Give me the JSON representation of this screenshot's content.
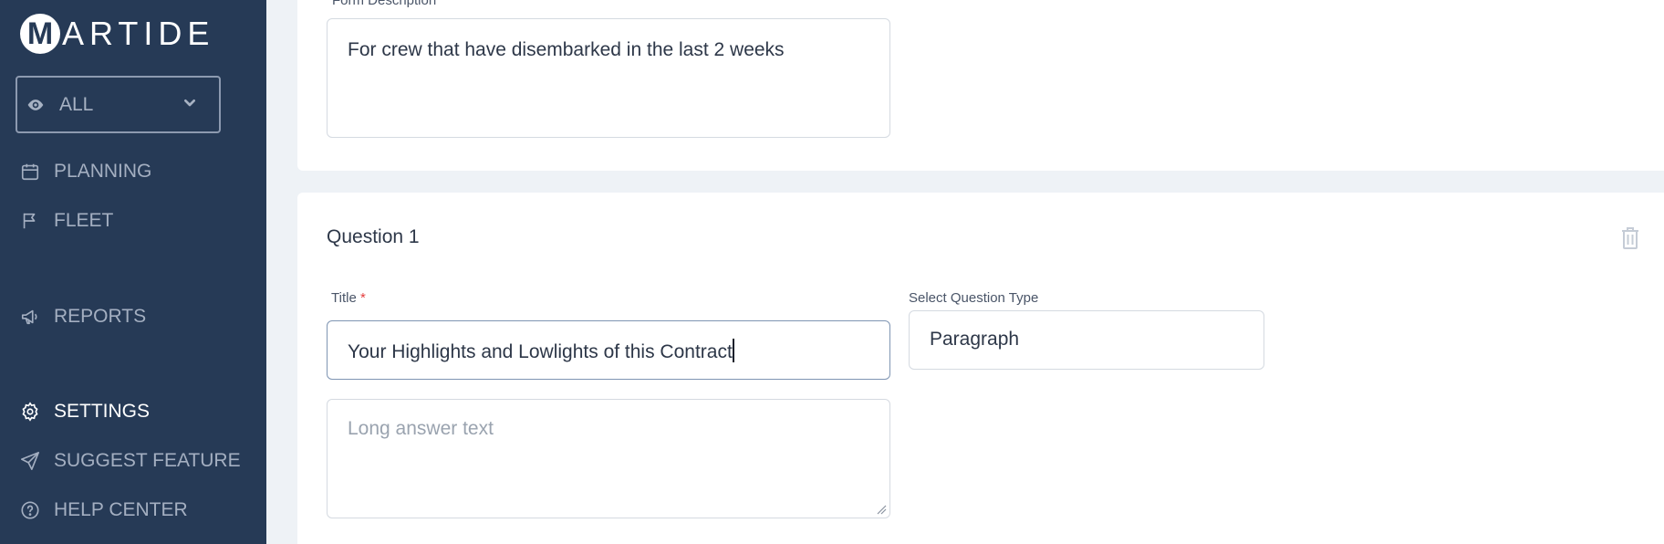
{
  "brand": {
    "logo_letter": "M",
    "logo_text": "ARTIDE"
  },
  "sidebar": {
    "view_select": {
      "value": "ALL",
      "icon": "eye-icon"
    },
    "items": [
      {
        "label": "PLANNING",
        "icon": "calendar-icon",
        "active": false
      },
      {
        "label": "FLEET",
        "icon": "flag-icon",
        "active": false
      },
      {
        "label": "REPORTS",
        "icon": "megaphone-icon",
        "active": false
      },
      {
        "label": "SETTINGS",
        "icon": "gear-icon",
        "active": true
      },
      {
        "label": "SUGGEST FEATURE",
        "icon": "send-icon",
        "active": false
      },
      {
        "label": "HELP CENTER",
        "icon": "help-circle-icon",
        "active": false
      }
    ]
  },
  "form": {
    "description_label": "Form Description",
    "description_value": "For crew that have disembarked in the last 2 weeks"
  },
  "question": {
    "heading": "Question 1",
    "title_label": "Title",
    "required_mark": "*",
    "title_value": "Your Highlights and Lowlights of this Contract",
    "type_label": "Select Question Type",
    "type_value": "Paragraph",
    "answer_placeholder": "Long answer text"
  },
  "colors": {
    "sidebar_bg": "#263a56",
    "page_bg": "#eef2f6",
    "required": "#e53e3e"
  }
}
